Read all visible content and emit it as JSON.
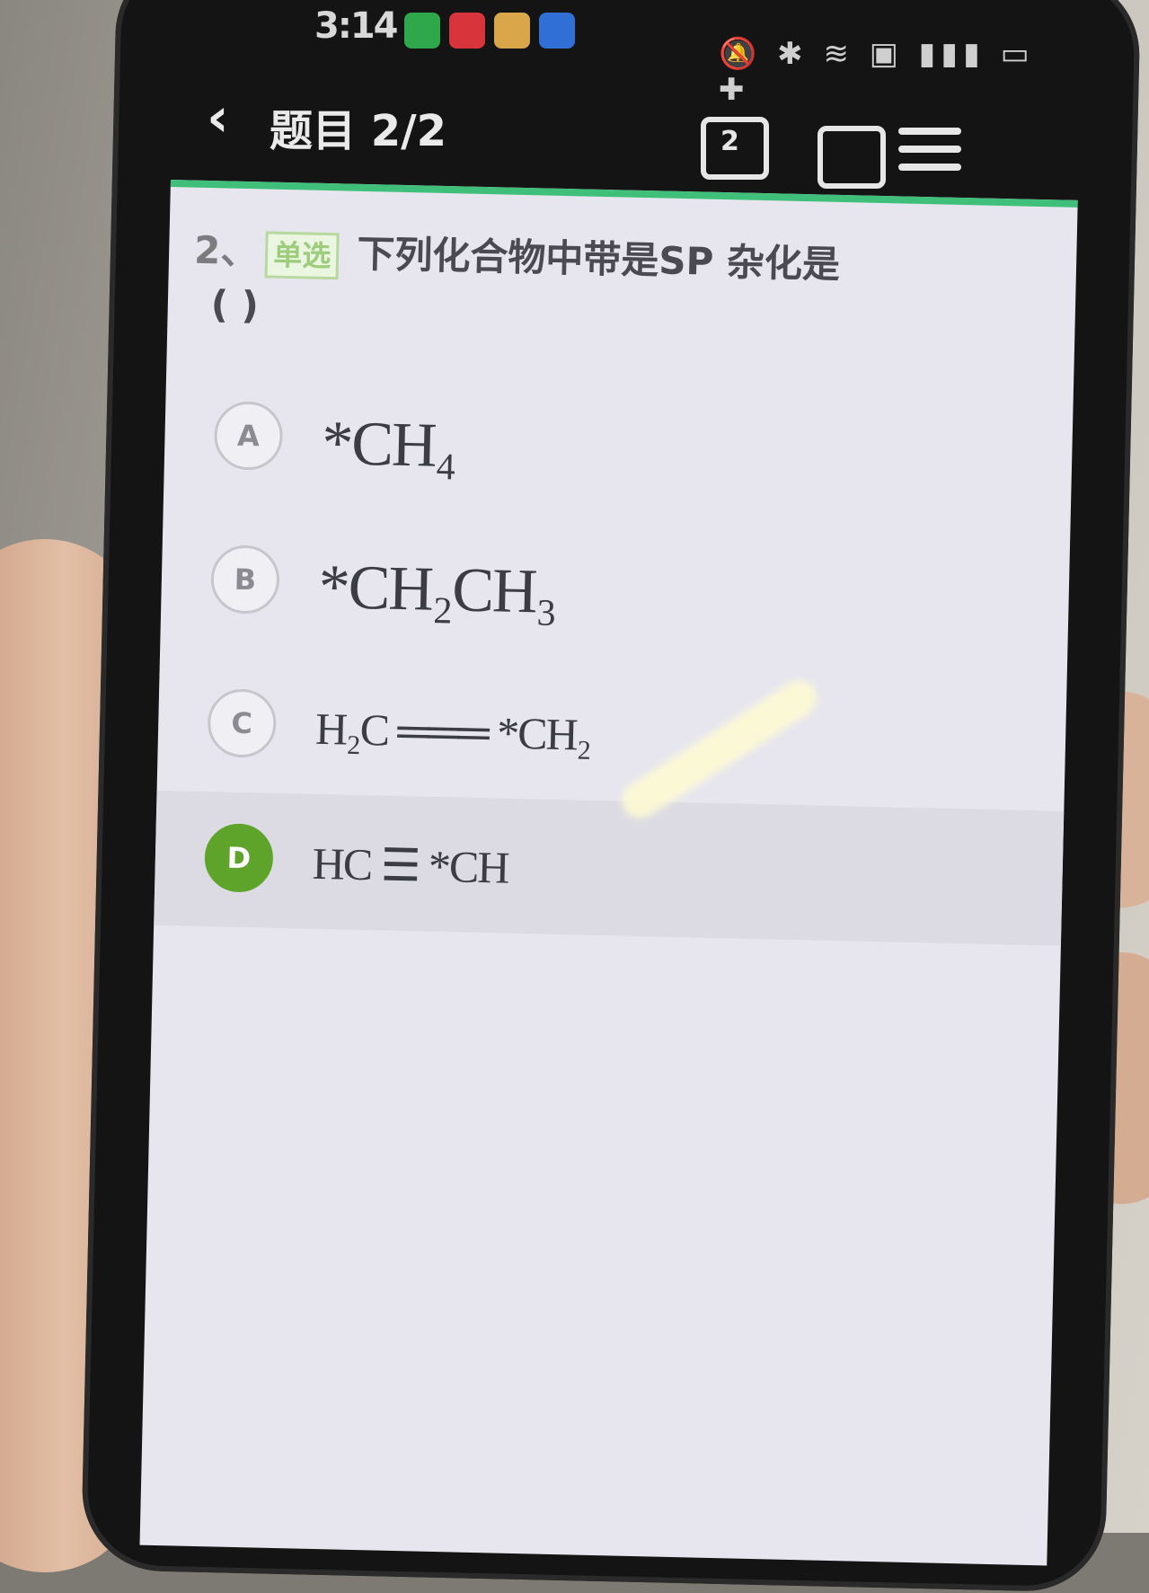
{
  "status_bar": {
    "time": "3:14",
    "indicators": "🔕 ✱ ≋ ▣ ▮▮▮ ▭ ✚"
  },
  "header": {
    "back_glyph": "‹",
    "title": "题目 2/2",
    "answer_icon_text": "2"
  },
  "question": {
    "number": "2、",
    "type": "单选",
    "text": "下列化合物中带是SP 杂化是",
    "blank": "(   )"
  },
  "options": [
    {
      "letter": "A",
      "formula": "*CH₄",
      "selected": false
    },
    {
      "letter": "B",
      "formula": "*CH₂CH₃",
      "selected": false
    },
    {
      "letter": "C",
      "formula": "H₂C ═══ *CH₂",
      "selected": false
    },
    {
      "letter": "D",
      "formula": "HC ☰ *CH",
      "selected": true
    }
  ],
  "colors": {
    "accent": "#3fbf7a",
    "selected": "#5fa42a",
    "screen_bg": "#e7e6ee"
  }
}
